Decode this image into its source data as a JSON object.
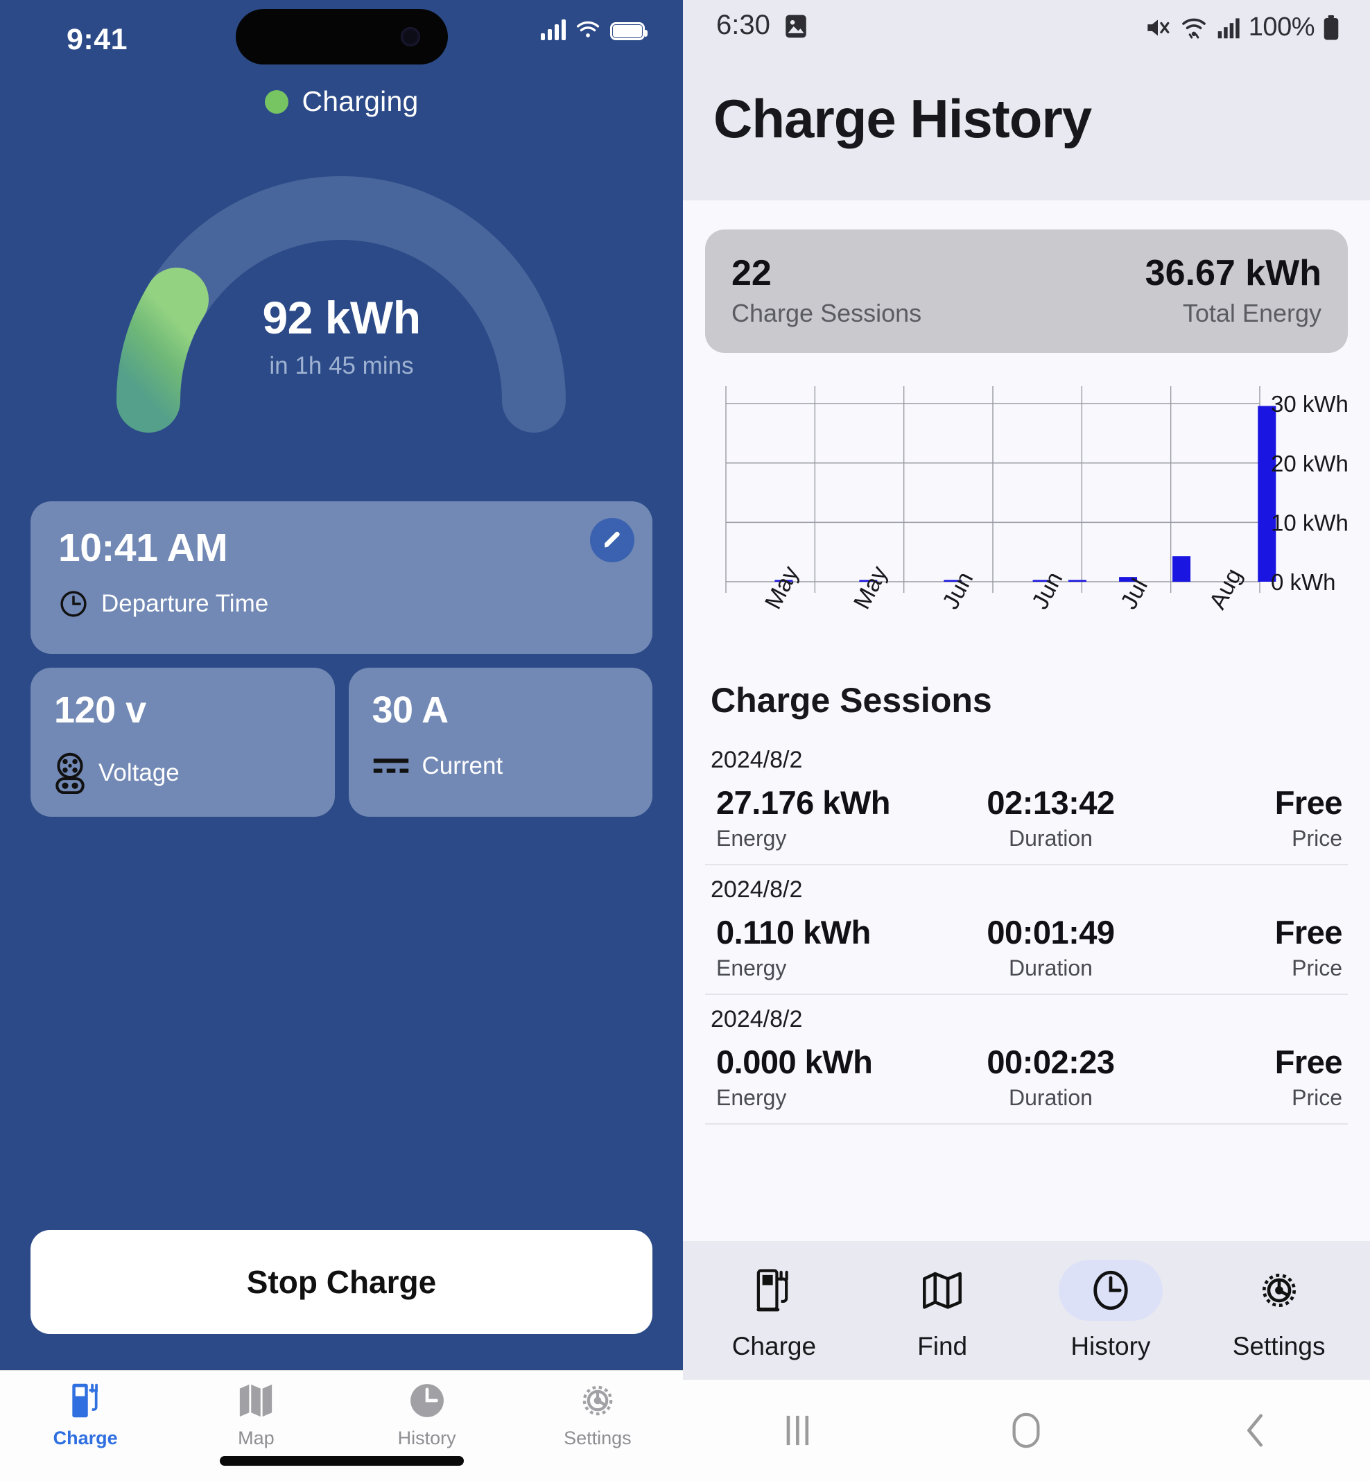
{
  "ios": {
    "status": {
      "time": "9:41",
      "signal_icon": "cellular-signal-icon",
      "wifi_icon": "wifi-icon",
      "battery_icon": "battery-icon"
    },
    "charge_status": {
      "label": "Charging",
      "dot_color": "#77c463"
    },
    "gauge": {
      "value": "92 kWh",
      "sub": "in 1h 45 mins",
      "progress_percent": 23,
      "track_color": "#48659c",
      "progress_from": "#8fd07b",
      "progress_to": "#4e9d85"
    },
    "departure_card": {
      "value": "10:41 AM",
      "label": "Departure Time",
      "icon": "clock-icon",
      "edit_icon": "pencil-icon"
    },
    "voltage_card": {
      "value": "120 v",
      "label": "Voltage",
      "icon": "ev-connector-icon"
    },
    "current_card": {
      "value": "30 A",
      "label": "Current",
      "icon": "dc-current-icon"
    },
    "stop_button": {
      "label": "Stop Charge"
    },
    "tabs": [
      {
        "label": "Charge",
        "icon": "charger-pump-icon",
        "active": true
      },
      {
        "label": "Map",
        "icon": "map-icon",
        "active": false
      },
      {
        "label": "History",
        "icon": "clock-icon",
        "active": false
      },
      {
        "label": "Settings",
        "icon": "gear-icon",
        "active": false
      }
    ],
    "accent_color": "#2f6fe0",
    "background_color": "#2b4a87"
  },
  "android": {
    "status": {
      "time": "6:30",
      "image_icon": "image-icon",
      "mute_icon": "mute-icon",
      "wifi_icon": "wifi-icon",
      "signal_icon": "cellular-signal-icon",
      "battery_percent": "100%",
      "battery_icon": "battery-icon"
    },
    "title": "Charge History",
    "summary": {
      "sessions_value": "22",
      "sessions_label": "Charge Sessions",
      "energy_value": "36.67 kWh",
      "energy_label": "Total Energy"
    },
    "sessions_heading": "Charge Sessions",
    "sessions": [
      {
        "date": "2024/8/2",
        "energy": "27.176 kWh",
        "energy_label": "Energy",
        "duration": "02:13:42",
        "duration_label": "Duration",
        "price": "Free",
        "price_label": "Price"
      },
      {
        "date": "2024/8/2",
        "energy": "0.110 kWh",
        "energy_label": "Energy",
        "duration": "00:01:49",
        "duration_label": "Duration",
        "price": "Free",
        "price_label": "Price"
      },
      {
        "date": "2024/8/2",
        "energy": "0.000 kWh",
        "energy_label": "Energy",
        "duration": "00:02:23",
        "duration_label": "Duration",
        "price": "Free",
        "price_label": "Price"
      }
    ],
    "tabs": [
      {
        "label": "Charge",
        "icon": "charger-pump-icon",
        "active": false
      },
      {
        "label": "Find",
        "icon": "map-icon",
        "active": false
      },
      {
        "label": "History",
        "icon": "clock-icon",
        "active": true
      },
      {
        "label": "Settings",
        "icon": "gear-icon",
        "active": false
      }
    ],
    "navbar": {
      "recents_icon": "recents-icon",
      "home_icon": "home-icon",
      "back_icon": "back-icon"
    },
    "accent_color": "#dde1f7"
  },
  "chart_data": {
    "type": "bar",
    "title": "",
    "xlabel": "",
    "ylabel": "",
    "categories": [
      "May",
      "May",
      "Jun",
      "Jun",
      "Jul",
      "Aug"
    ],
    "tick_labels_y": [
      "0 kWh",
      "10 kWh",
      "20 kWh",
      "30 kWh"
    ],
    "ylim": [
      0,
      32
    ],
    "yticks": [
      0,
      10,
      20,
      30
    ],
    "grid": true,
    "legend": "none",
    "bar_color": "#1a15e0",
    "bars": [
      {
        "x": 0.15,
        "value": 0.0
      },
      {
        "x": 1.1,
        "value": 0.0
      },
      {
        "x": 2.05,
        "value": 0.0
      },
      {
        "x": 3.05,
        "value": 0.1
      },
      {
        "x": 3.45,
        "value": 0.25
      },
      {
        "x": 4.02,
        "value": 0.8
      },
      {
        "x": 4.62,
        "value": 4.3
      },
      {
        "x": 5.58,
        "value": 29.6
      }
    ]
  }
}
